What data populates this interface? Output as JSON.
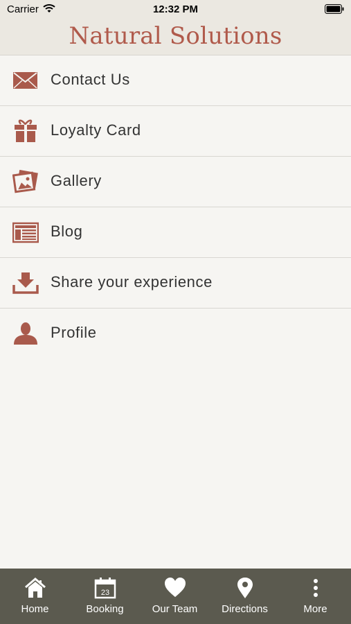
{
  "status_bar": {
    "carrier": "Carrier",
    "time": "12:32 PM"
  },
  "header": {
    "title": "Natural Solutions"
  },
  "menu": {
    "items": [
      {
        "label": "Contact Us",
        "icon": "envelope-icon"
      },
      {
        "label": "Loyalty Card",
        "icon": "gift-icon"
      },
      {
        "label": "Gallery",
        "icon": "photos-icon"
      },
      {
        "label": "Blog",
        "icon": "newspaper-icon"
      },
      {
        "label": "Share your experience",
        "icon": "download-tray-icon"
      },
      {
        "label": "Profile",
        "icon": "user-icon"
      }
    ]
  },
  "tab_bar": {
    "tabs": [
      {
        "label": "Home",
        "icon": "home-icon"
      },
      {
        "label": "Booking",
        "icon": "calendar-icon",
        "calendar_day": "23"
      },
      {
        "label": "Our Team",
        "icon": "heart-icon"
      },
      {
        "label": "Directions",
        "icon": "map-pin-icon"
      },
      {
        "label": "More",
        "icon": "more-vertical-icon"
      }
    ]
  },
  "colors": {
    "brand": "#b05a4b",
    "icon": "#a95a4c",
    "header_bg": "#ebe8e1",
    "tab_bar_bg": "#5b5a4f",
    "page_bg": "#f6f5f2"
  }
}
